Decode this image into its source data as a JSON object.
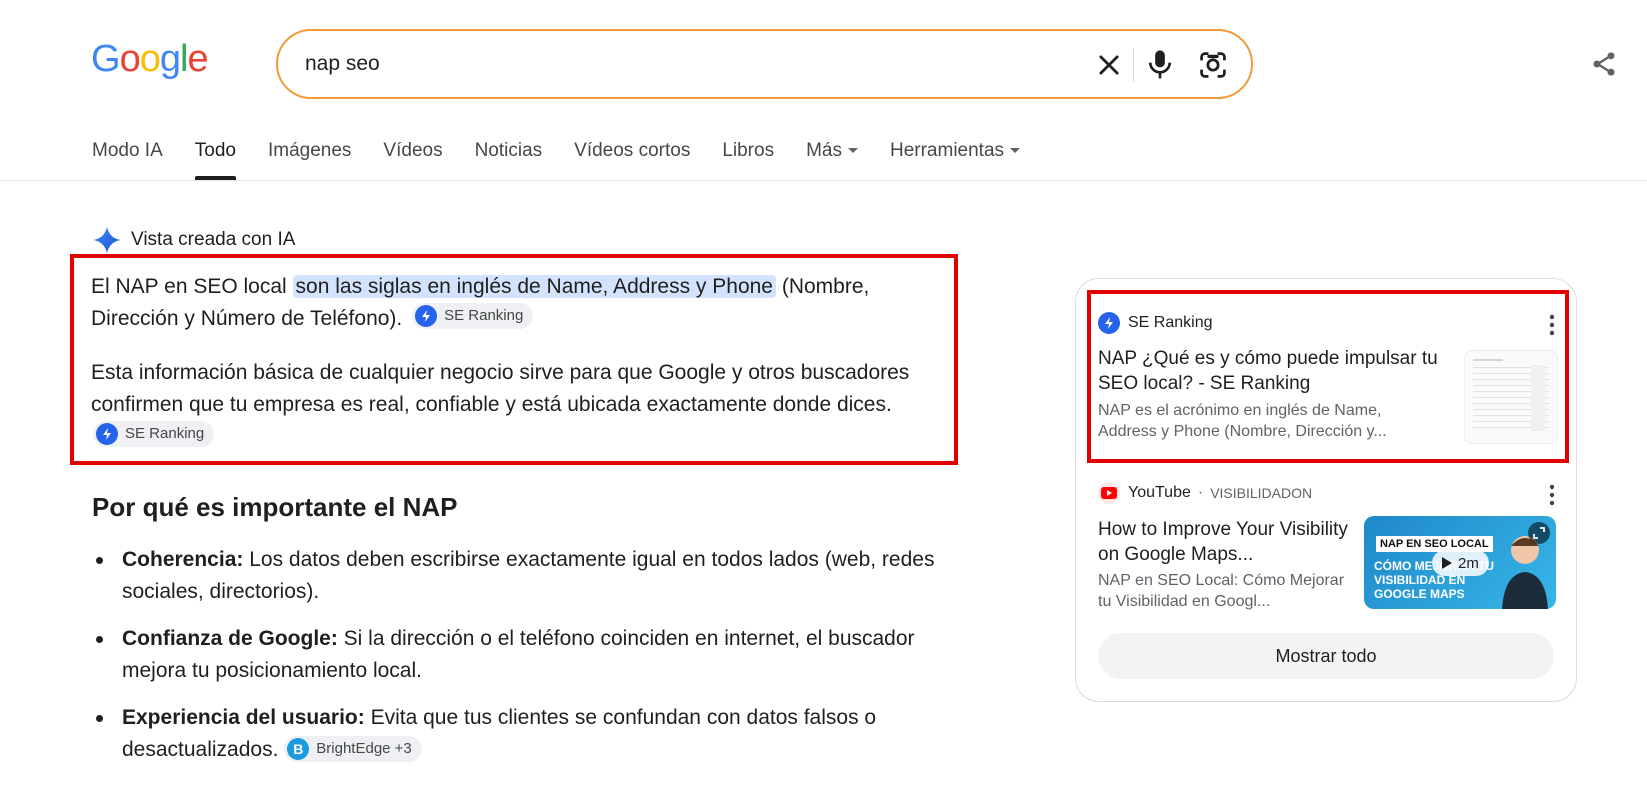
{
  "header": {
    "logo_letters": [
      {
        "ch": "G",
        "color": "#4285f4"
      },
      {
        "ch": "o",
        "color": "#ea4335"
      },
      {
        "ch": "o",
        "color": "#fbbc05"
      },
      {
        "ch": "g",
        "color": "#4285f4"
      },
      {
        "ch": "l",
        "color": "#34a853"
      },
      {
        "ch": "e",
        "color": "#ea4335"
      }
    ],
    "search_value": "nap seo",
    "search_border_color": "#f29a38"
  },
  "tabs": [
    {
      "label": "Modo IA",
      "active": false
    },
    {
      "label": "Todo",
      "active": true
    },
    {
      "label": "Imágenes",
      "active": false
    },
    {
      "label": "Vídeos",
      "active": false
    },
    {
      "label": "Noticias",
      "active": false
    },
    {
      "label": "Vídeos cortos",
      "active": false
    },
    {
      "label": "Libros",
      "active": false
    },
    {
      "label": "Más",
      "active": false,
      "caret": true
    },
    {
      "label": "Herramientas",
      "active": false,
      "caret": true
    }
  ],
  "ai_overview": {
    "heading": "Vista creada con IA",
    "p1_before": "El NAP en SEO local ",
    "p1_highlight": "son las siglas en inglés de Name, Address y Phone",
    "p1_after": " (Nombre, Dirección y Número de Teléfono).",
    "p2": "Esta información básica de cualquier negocio sirve para que Google y otros buscadores confirmen que tu empresa es real, confiable y está ubicada exactamente donde dices.",
    "chip_se_ranking": "SE Ranking",
    "section_title": "Por qué es importante el NAP",
    "bullets": [
      {
        "term": "Coherencia:",
        "text": " Los datos deben escribirse exactamente igual en todos lados (web, redes sociales, directorios)."
      },
      {
        "term": "Confianza de Google:",
        "text": " Si la dirección o el teléfono coinciden en internet, el buscador mejora tu posicionamiento local."
      },
      {
        "term": "Experiencia del usuario:",
        "text": " Evita que tus clientes se confundan con datos falsos o desactualizados. "
      }
    ],
    "chip_brightedge": "BrightEdge +3"
  },
  "panel": {
    "card1": {
      "source": "SE Ranking",
      "title": "NAP ¿Qué es y cómo puede impulsar tu SEO local? - SE Ranking",
      "snippet": "NAP es el acrónimo en inglés de Name, Address y Phone (Nombre, Dirección y..."
    },
    "card2": {
      "source": "YouTube",
      "channel": "VISIBILIDADON",
      "title": "How to Improve Your Visibility on Google Maps...",
      "snippet": "NAP en SEO Local: Cómo Mejorar tu Visibilidad en Googl...",
      "thumb_badge": "NAP EN SEO LOCAL",
      "thumb_text": "CÓMO MEJORAR TU VISIBILIDAD EN GOOGLE MAPS",
      "duration": "2m"
    },
    "show_all": "Mostrar todo"
  },
  "colors": {
    "highlight": "#d3e3fd",
    "annotation_red": "#e00000",
    "se_ranking_blue": "#2563eb",
    "youtube_red": "#ff0000",
    "brightedge_blue": "#1a9ae0"
  }
}
